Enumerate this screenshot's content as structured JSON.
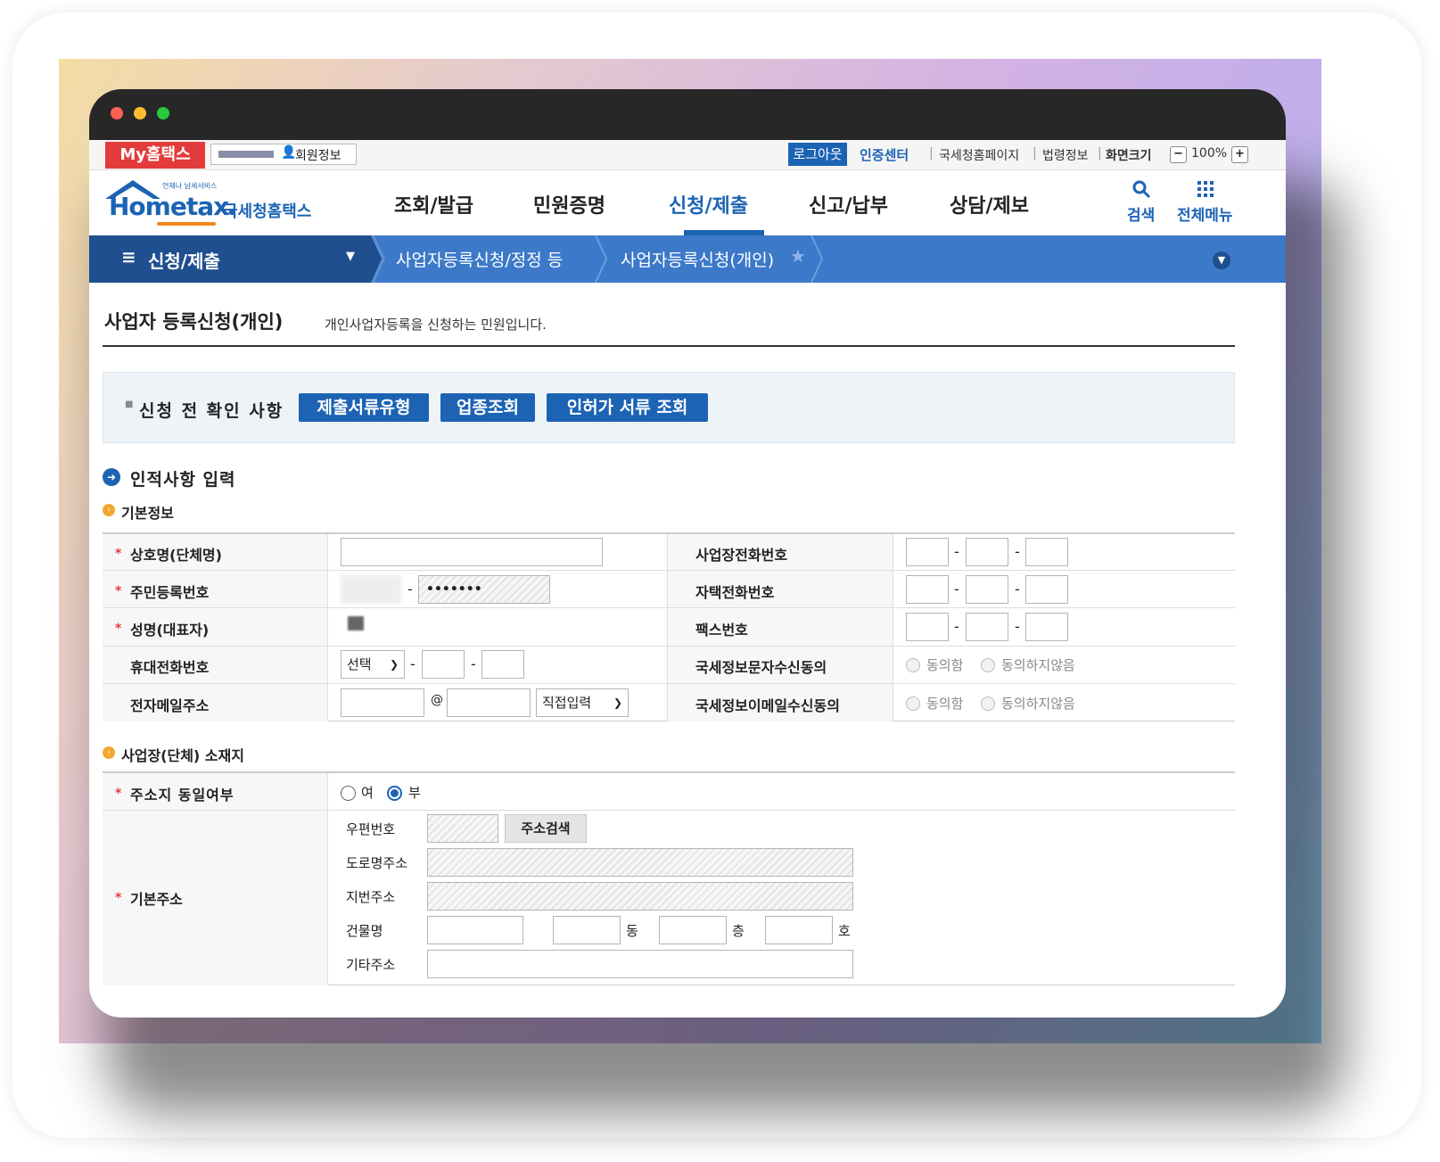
{
  "util_bar": {
    "my_hometax": "My홈택스",
    "member_info": "회원정보",
    "logout": "로그아웃",
    "cert_center": "인증센터",
    "links": [
      "국세청홈페이지",
      "법령정보",
      "화면크기"
    ],
    "zoom_minus": "−",
    "zoom_level": "100%",
    "zoom_plus": "+"
  },
  "header": {
    "logo_small": "언제나 납세서비스",
    "logo_main": "Hometax.",
    "logo_kr": "국세청홈택스",
    "nav": [
      "조회/발급",
      "민원증명",
      "신청/제출",
      "신고/납부",
      "상담/제보"
    ],
    "search": "검색",
    "all_menu": "전체메뉴"
  },
  "breadcrumb": {
    "section": "신청/제출",
    "level1": "사업자등록신청/정정 등",
    "level2": "사업자등록신청(개인)"
  },
  "page": {
    "title": "사업자 등록신청(개인)",
    "subtitle": "개인사업자등록을 신청하는 민원입니다.",
    "precheck_label": "신청 전 확인 사항",
    "precheck_buttons": [
      "제출서류유형",
      "업종조회",
      "인허가 서류 조회"
    ],
    "section_personal": "인적사항 입력",
    "section_basic": "기본정보",
    "section_location": "사업장(단체) 소재지"
  },
  "form": {
    "trade_name": "상호명(단체명)",
    "resident_no": "주민등록번호",
    "resident_masked": "•••••••",
    "name": "성명(대표자)",
    "mobile": "휴대전화번호",
    "mobile_select": "선택",
    "email": "전자메일주소",
    "email_at": "@",
    "email_domain_select": "직접입력",
    "biz_phone": "사업장전화번호",
    "home_phone": "자택전화번호",
    "fax": "팩스번호",
    "sms_consent": "국세정보문자수신동의",
    "email_consent": "국세정보이메일수신동의",
    "agree": "동의함",
    "disagree": "동의하지않음",
    "dash": "-",
    "same_address": "주소지 동일여부",
    "yes": "여",
    "no": "부",
    "basic_address": "기본주소",
    "postal": "우편번호",
    "address_search": "주소검색",
    "road_address": "도로명주소",
    "lot_address": "지번주소",
    "building": "건물명",
    "dong": "동",
    "floor": "층",
    "ho": "호",
    "other_address": "기타주소"
  },
  "colors": {
    "brand_blue": "#1c63b4",
    "breadcrumb_bar": "#3c79c9",
    "breadcrumb_dark": "#1f4f8f",
    "red": "#e33b3b",
    "orange_bullet": "#f0a830"
  }
}
